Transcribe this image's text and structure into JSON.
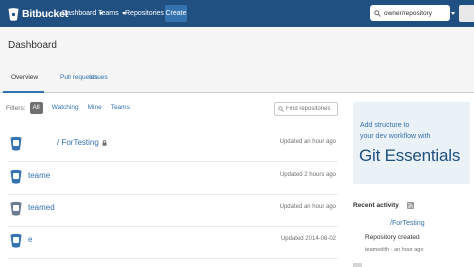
{
  "topbar": {
    "brand": "Bitbucket",
    "nav": [
      {
        "label": "Dashboard",
        "icon": "caret-down-icon"
      },
      {
        "label": "Teams",
        "icon": "caret-down-icon"
      },
      {
        "label": "Repositories",
        "icon": "caret-down-icon"
      }
    ],
    "create_label": "Create",
    "search_value": "owner/repository",
    "help_glyph": "?",
    "colors": {
      "bar": "#205081",
      "accent": "#3572b0"
    }
  },
  "page": {
    "title": "Dashboard",
    "tabs": [
      {
        "label": "Overview",
        "active": true
      },
      {
        "label": "Pull requests",
        "active": false
      },
      {
        "label": "Issues",
        "active": false
      }
    ]
  },
  "filters": {
    "label": "Filters:",
    "items": [
      {
        "label": "All",
        "active": true
      },
      {
        "label": "Watching",
        "active": false
      },
      {
        "label": "Mine",
        "active": false
      },
      {
        "label": "Teams",
        "active": false
      }
    ],
    "search_placeholder": "Find repositories"
  },
  "repos": [
    {
      "name": "/ ForTesting",
      "private": true,
      "updated": "Updated an hour ago"
    },
    {
      "name": "teame",
      "private": false,
      "updated": "Updated 2 hours ago"
    },
    {
      "name": "teamed",
      "private": false,
      "updated": "Updated an hour ago"
    },
    {
      "name": "e",
      "private": false,
      "updated": "Updated 2014-06-02"
    }
  ],
  "promo": {
    "line1": "Add structure to",
    "line2": "your dev workflow with",
    "title": "Git Essentials"
  },
  "activity": {
    "title": "Recent activity",
    "repo": "/ForTesting",
    "text": "Repository created",
    "meta": "teamedith · an hour ago"
  }
}
